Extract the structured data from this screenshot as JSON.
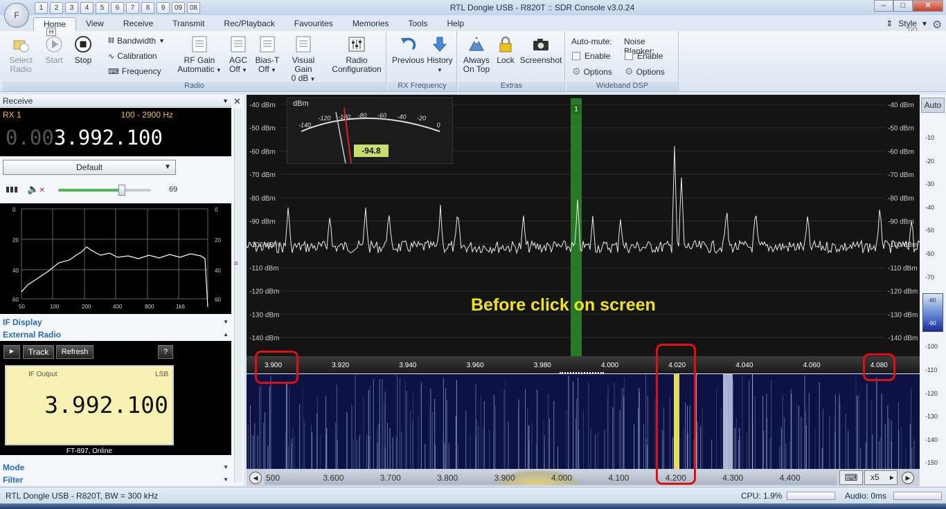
{
  "window": {
    "title": "RTL Dongle USB - R820T :: SDR Console v3.0.24",
    "app_button_key": "F",
    "quick_access_keys": [
      "1",
      "2",
      "3",
      "4",
      "5",
      "6",
      "7",
      "8",
      "9",
      "09",
      "08"
    ],
    "style_label": "Style",
    "style_key": "S",
    "home_key": "H"
  },
  "tabs": [
    "Home",
    "View",
    "Receive",
    "Transmit",
    "Rec/Playback",
    "Favourites",
    "Memories",
    "Tools",
    "Help"
  ],
  "ribbon": {
    "radio_group": {
      "label": "Radio",
      "select_radio": "Select\nRadio",
      "start": "Start",
      "stop": "Stop",
      "bandwidth": "Bandwidth",
      "calibration": "Calibration",
      "frequency": "Frequency",
      "rf_gain": "RF Gain",
      "rf_gain_value": "Automatic",
      "agc": "AGC",
      "agc_value": "Off",
      "bias_t": "Bias-T",
      "bias_t_value": "Off",
      "visual_gain": "Visual Gain",
      "visual_gain_value": "0 dB",
      "radio_config": "Radio",
      "radio_config_2": "Configuration"
    },
    "rx_frequency_group": {
      "label": "RX Frequency",
      "previous": "Previous",
      "history": "History"
    },
    "extras_group": {
      "label": "Extras",
      "always_on_top_1": "Always",
      "always_on_top_2": "On Top",
      "lock": "Lock",
      "screenshot": "Screenshot"
    },
    "wideband_dsp_group": {
      "label": "Wideband DSP",
      "auto_mute": "Auto-mute:",
      "enable": "Enable",
      "options": "Options",
      "noise_blanker": "Noise Blanker:",
      "nb_enable": "Enable",
      "nb_options": "Options"
    }
  },
  "left_panel": {
    "receive_header": "Receive",
    "rx_name": "RX 1",
    "filter_range": "100 - 2900 Hz",
    "frequency_dim": "0.00",
    "frequency_bright": "3.992.100",
    "preset": "Default",
    "volume_value": "69",
    "volume_fraction": 0.69,
    "eq_y_ticks": [
      "0",
      "20",
      "40",
      "60"
    ],
    "eq_x_ticks": [
      "50",
      "100",
      "200",
      "400",
      "800",
      "1k6"
    ],
    "if_display": "IF Display",
    "external_radio": "External Radio",
    "track": "Track",
    "refresh": "Refresh",
    "help": "?",
    "if_output_label": "IF Output",
    "if_mode": "LSB",
    "if_frequency": "3.992.100",
    "radio_status": "FT-897, Online",
    "mode": "Mode",
    "filter": "Filter"
  },
  "spectrum": {
    "db_labels": [
      "-40 dBm",
      "-50 dBm",
      "-60 dBm",
      "-70 dBm",
      "-80 dBm",
      "-90 dBm",
      "-100 dBm",
      "-110 dBm",
      "-120 dBm",
      "-130 dBm",
      "-140 dBm"
    ],
    "meter_unit": "dBm",
    "meter_scale": [
      "-140",
      "-120",
      "-100",
      "-80",
      "-60",
      "-40",
      "-20",
      "0"
    ],
    "meter_reading": "-94.8",
    "vfo_marker": "1",
    "annotation": "Before click on screen",
    "freq_labels": [
      "3.900",
      "3.920",
      "3.940",
      "3.960",
      "3.980",
      "4.000",
      "4.020",
      "4.040",
      "4.060",
      "4.080"
    ],
    "auto_button": "Auto"
  },
  "waterfall": {
    "overview_labels": [
      "500",
      "3.600",
      "3.700",
      "3.800",
      "3.900",
      "4.000",
      "4.100",
      "4.200",
      "4.300",
      "4.400"
    ],
    "zoom": "x5",
    "colorbar_ticks": [
      "-10",
      "-20",
      "-30",
      "-40",
      "-50",
      "-60",
      "-70",
      "-80",
      "-90",
      "-100",
      "-110",
      "-120",
      "-130",
      "-140",
      "-150"
    ],
    "colorbar_hi": "-80",
    "colorbar_lo": "-90"
  },
  "status": {
    "device": "RTL Dongle USB - R820T, BW = 300 kHz",
    "cpu": "CPU: 1.9%",
    "audio": "Audio: 0ms"
  }
}
